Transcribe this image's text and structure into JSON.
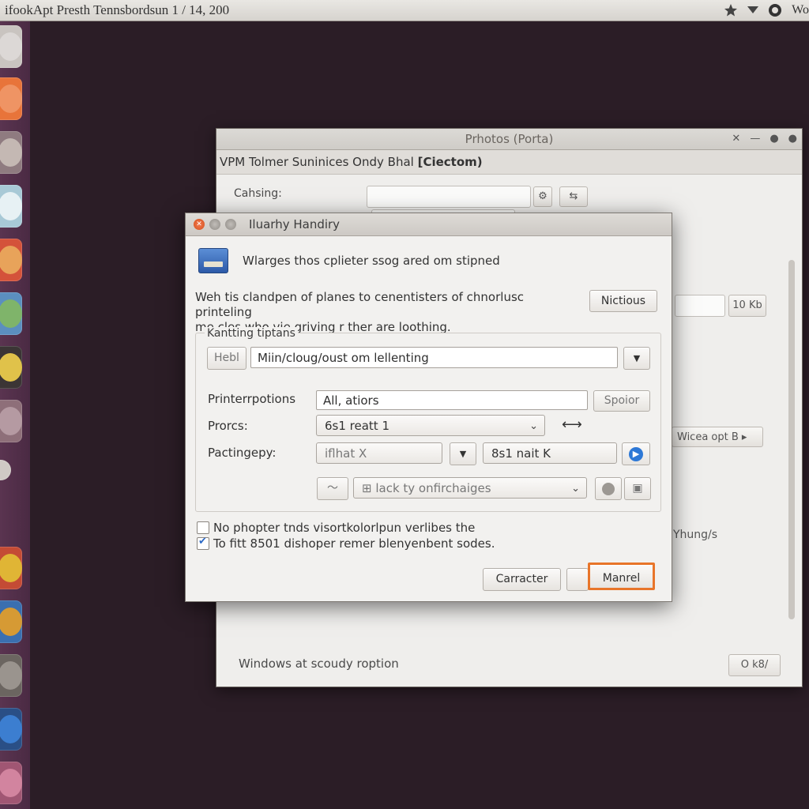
{
  "top_panel": {
    "title": "ifookApt Presth   Tennsbordsun   1 / 14,  200",
    "indicator_text": "Wo"
  },
  "launcher": {
    "items": [
      {
        "name": "help-icon",
        "color": "#c9c4c0"
      },
      {
        "name": "orange-app-icon",
        "color": "#e8743a"
      },
      {
        "name": "disc-icon",
        "color": "#c4b8b3"
      },
      {
        "name": "lock-app-icon",
        "color": "#d8e6ec"
      },
      {
        "name": "red-app-icon",
        "color": "#d4523a"
      },
      {
        "name": "globe-icon",
        "color": "#7fb46a"
      },
      {
        "name": "camera-icon",
        "color": "#e0c24a"
      },
      {
        "name": "pink-app-icon",
        "color": "#b59aa2"
      },
      {
        "name": "small-dot-icon",
        "color": "#cfc9c5"
      },
      {
        "name": "chrome-icon",
        "color": "#e0b535"
      },
      {
        "name": "files-icon",
        "color": "#d69a34"
      },
      {
        "name": "tools-icon",
        "color": "#9a948e"
      },
      {
        "name": "blue-ring-icon",
        "color": "#3c7ed0"
      },
      {
        "name": "pink-ball-icon",
        "color": "#d2849f"
      }
    ]
  },
  "bg_window": {
    "title": "Prhotos (Porta)",
    "menubar": "VPM  Tolmer Suninices  Ondy Bhal ",
    "menubar_bold": "[Ciectom)",
    "caching_label": "Cahsing:",
    "field_value": "10 Kb",
    "combo_value": "Wicea opt B",
    "side_text": "Yhung/s",
    "footer_text": "Windows at scoudy roption",
    "footer_button": "O k8/"
  },
  "dialog": {
    "title": "Iluarhy Handiry",
    "header_text": "Wlarges thos cplieter ssog ared om stipned",
    "description_line1": "Weh tis clandpen of planes to cenentisters of chnorlusc printeling",
    "description_line2": "me cles who vie griving r ther are loothing.",
    "top_button": "Nictious",
    "frame_label": "Kantting tiptans",
    "head_label": "Hebl",
    "path_value": "Miin/cloug/oust om lellenting",
    "options_label": "Printerrpotions",
    "options_value": "All, atiors",
    "options_button": "Spoior",
    "procs_label": "Prorcs:",
    "procs_value": "6s1 reatt 1",
    "paging_label": "Pactingepy:",
    "paging_value_left": "iflhat X",
    "paging_value_right": "8s1 nait K",
    "checklist_value": "lack ty onfirchaiges",
    "check1_label": "No phopter tnds visortkolorlpun verlibes the",
    "check1_checked": false,
    "check2_label": "To fitt 8501 dishoper remer blenyenbent sodes.",
    "check2_checked": true,
    "cancel_button": "Carracter",
    "ok_button": "Manrel",
    "accent_color": "#e8752a"
  }
}
